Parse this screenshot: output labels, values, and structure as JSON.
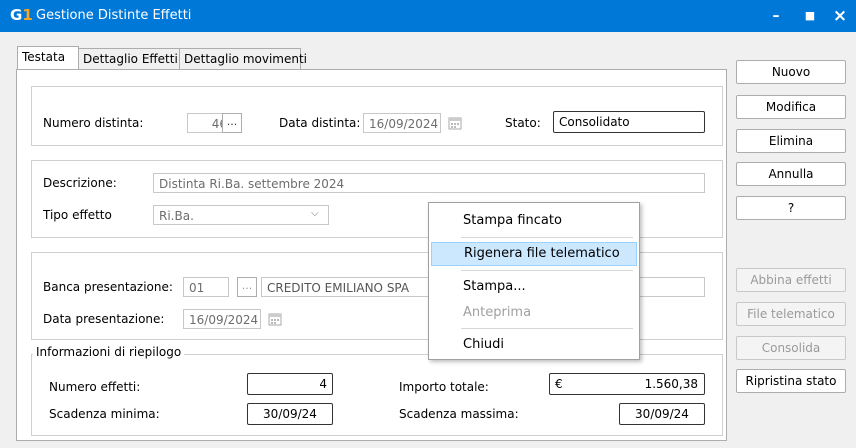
{
  "window": {
    "title": "Gestione Distinte Effetti",
    "logo_g": "G",
    "logo_1": "1",
    "minimize": "–",
    "maximize": "■",
    "close": "×"
  },
  "tabs": [
    "Testata",
    "Dettaglio Effetti",
    "Dettaglio movimenti"
  ],
  "header": {
    "numero_label": "Numero distinta:",
    "numero_value": "46",
    "ellipsis": "...",
    "data_label": "Data distinta:",
    "data_value": "16/09/2024",
    "stato_label": "Stato:",
    "stato_value": "Consolidato"
  },
  "descr": {
    "descrizione_label": "Descrizione:",
    "descrizione_value": "Distinta Ri.Ba. settembre 2024",
    "tipo_label": "Tipo effetto",
    "tipo_value": "Ri.Ba."
  },
  "banca": {
    "banca_label": "Banca presentazione:",
    "banca_code": "01",
    "ellipsis": "...",
    "banca_name": "CREDITO EMILIANO SPA",
    "data_label": "Data presentazione:",
    "data_value": "16/09/2024"
  },
  "riepilogo": {
    "legend": "Informazioni di riepilogo",
    "numero_label": "Numero effetti:",
    "numero_value": "4",
    "importo_label": "Importo totale:",
    "currency": "€",
    "importo_value": "1.560,38",
    "scad_min_label": "Scadenza minima:",
    "scad_min_value": "30/09/24",
    "scad_max_label": "Scadenza massima:",
    "scad_max_value": "30/09/24"
  },
  "side_buttons": {
    "nuovo": "Nuovo",
    "modifica": "Modifica",
    "elimina": "Elimina",
    "annulla": "Annulla",
    "help": "?",
    "abbina": "Abbina effetti",
    "file_telematico": "File telematico",
    "consolida": "Consolida",
    "ripristina": "Ripristina stato"
  },
  "context_menu": {
    "items": [
      "Stampa fincato",
      "Rigenera file telematico",
      "Stampa...",
      "Anteprima",
      "Chiudi"
    ],
    "selected": "Rigenera file telematico"
  },
  "colors": {
    "titlebar": "#0078d7",
    "menu_highlight": "#cce8ff"
  }
}
